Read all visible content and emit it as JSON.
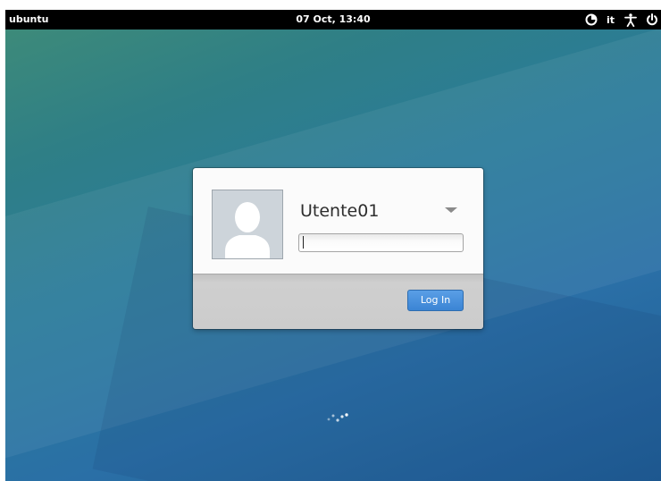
{
  "topbar": {
    "hostname": "ubuntu",
    "datetime": "07 Oct, 13:40",
    "keyboard_layout": "it",
    "icons": [
      "session-icon",
      "accessibility-icon",
      "power-icon"
    ]
  },
  "login": {
    "username": "Utente01",
    "password_value": "",
    "login_button_label": "Log In"
  },
  "colors": {
    "topbar_bg": "#000000",
    "button_blue": "#3b84d4",
    "dialog_bg": "#fbfbfb",
    "dialog_footer": "#cccccc"
  }
}
